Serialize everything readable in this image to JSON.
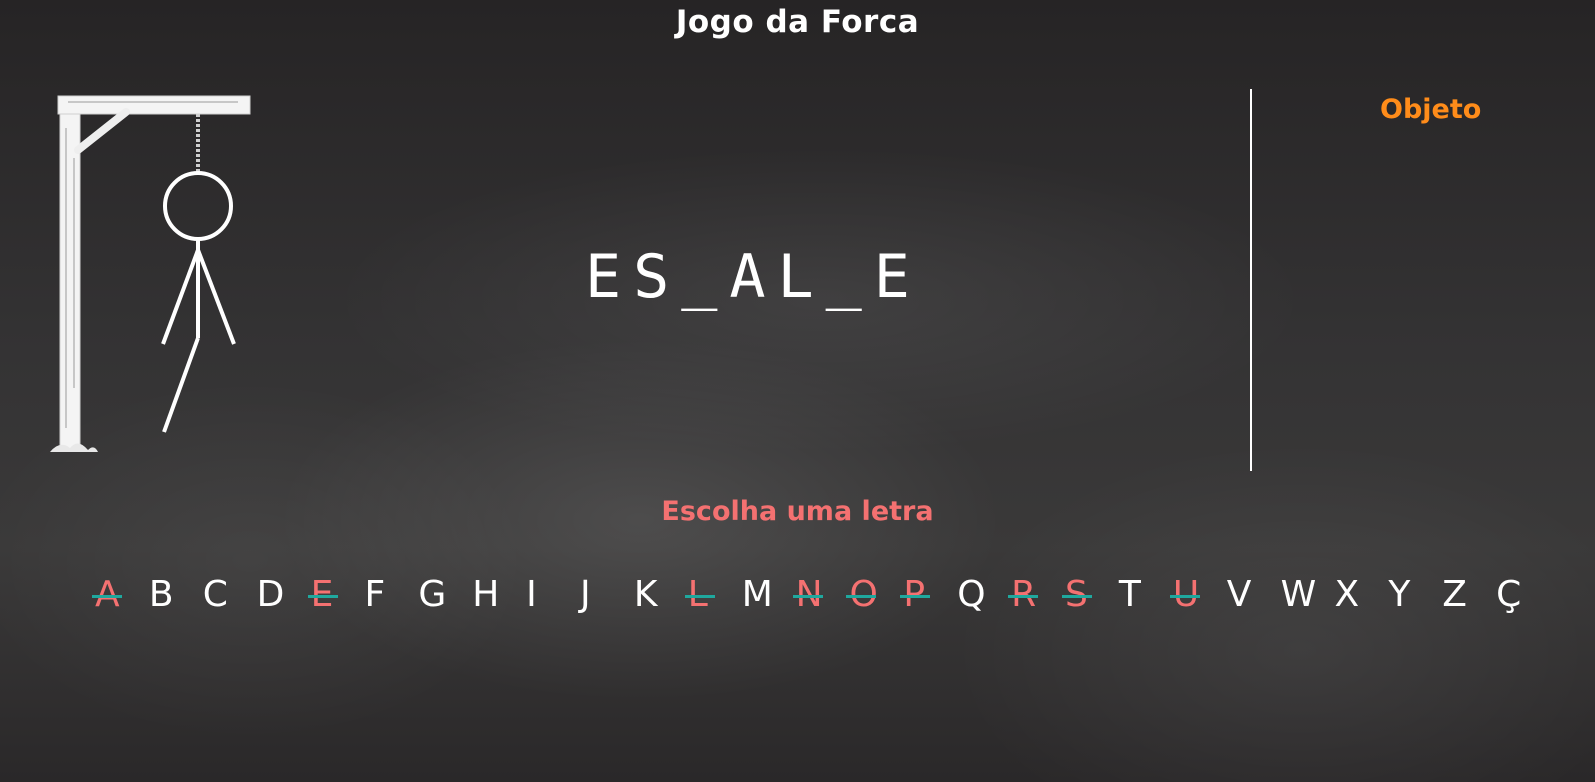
{
  "game": {
    "title": "Jogo da Forca",
    "category": "Objeto",
    "masked_word": "ES_AL_E",
    "prompt": "Escolha uma letra",
    "wrong_guesses": 5,
    "hangman_parts_shown": [
      "head",
      "body",
      "left-arm",
      "right-arm",
      "left-leg"
    ]
  },
  "alphabet": [
    {
      "letter": "A",
      "used": true
    },
    {
      "letter": "B",
      "used": false
    },
    {
      "letter": "C",
      "used": false
    },
    {
      "letter": "D",
      "used": false
    },
    {
      "letter": "E",
      "used": true
    },
    {
      "letter": "F",
      "used": false
    },
    {
      "letter": "G",
      "used": false
    },
    {
      "letter": "H",
      "used": false
    },
    {
      "letter": "I",
      "used": false
    },
    {
      "letter": "J",
      "used": false
    },
    {
      "letter": "K",
      "used": false
    },
    {
      "letter": "L",
      "used": true
    },
    {
      "letter": "M",
      "used": false
    },
    {
      "letter": "N",
      "used": true
    },
    {
      "letter": "O",
      "used": true
    },
    {
      "letter": "P",
      "used": true
    },
    {
      "letter": "Q",
      "used": false
    },
    {
      "letter": "R",
      "used": true
    },
    {
      "letter": "S",
      "used": true
    },
    {
      "letter": "T",
      "used": false
    },
    {
      "letter": "U",
      "used": true
    },
    {
      "letter": "V",
      "used": false
    },
    {
      "letter": "W",
      "used": false
    },
    {
      "letter": "X",
      "used": false
    },
    {
      "letter": "Y",
      "used": false
    },
    {
      "letter": "Z",
      "used": false
    },
    {
      "letter": "Ç",
      "used": false
    }
  ],
  "colors": {
    "background": "#2f2d2e",
    "text": "#ffffff",
    "category": "#ff8c1a",
    "prompt": "#f47171",
    "used_letter": "#f47171",
    "strike": "#1fa89e"
  }
}
